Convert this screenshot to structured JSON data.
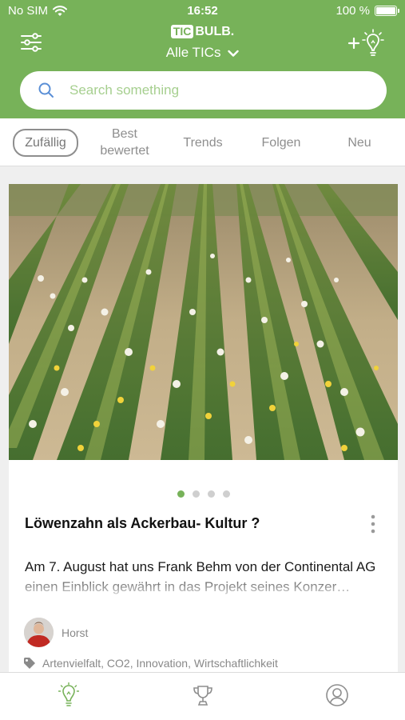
{
  "status_bar": {
    "carrier": "No SIM",
    "time": "16:52",
    "battery_text": "100 %",
    "battery_level": 1.0
  },
  "header": {
    "logo_part1": "TIC",
    "logo_part2": "BULB.",
    "filter_label": "Alle TICs",
    "menu_icon": "sliders-icon",
    "add_icon": "add-lightbulb-icon"
  },
  "search": {
    "placeholder": "Search something",
    "value": ""
  },
  "tabs": [
    {
      "label": "Zufällig",
      "active": true
    },
    {
      "label": "Best bewertet",
      "active": false
    },
    {
      "label": "Trends",
      "active": false
    },
    {
      "label": "Folgen",
      "active": false
    },
    {
      "label": "Neu",
      "active": false
    }
  ],
  "card": {
    "image_alt": "dandelion-field-photo",
    "slide_count": 4,
    "active_slide": 1,
    "title": "Löwenzahn als Ackerbau- Kultur ?",
    "description": "Am 7. August hat uns Frank Behm von der Continental AG einen Einblick gewährt in das Projekt seines Konzer…",
    "author": "Horst",
    "tags": "Artenvielfalt, CO2, Innovation, Wirtschaftlichkeit"
  },
  "bottom_nav": [
    {
      "icon": "lightbulb-icon",
      "active": true
    },
    {
      "icon": "trophy-icon",
      "active": false
    },
    {
      "icon": "profile-icon",
      "active": false
    }
  ],
  "colors": {
    "brand_green": "#77b259",
    "light_green": "#a6cf8f",
    "inactive_gray": "#8e8e8e"
  }
}
